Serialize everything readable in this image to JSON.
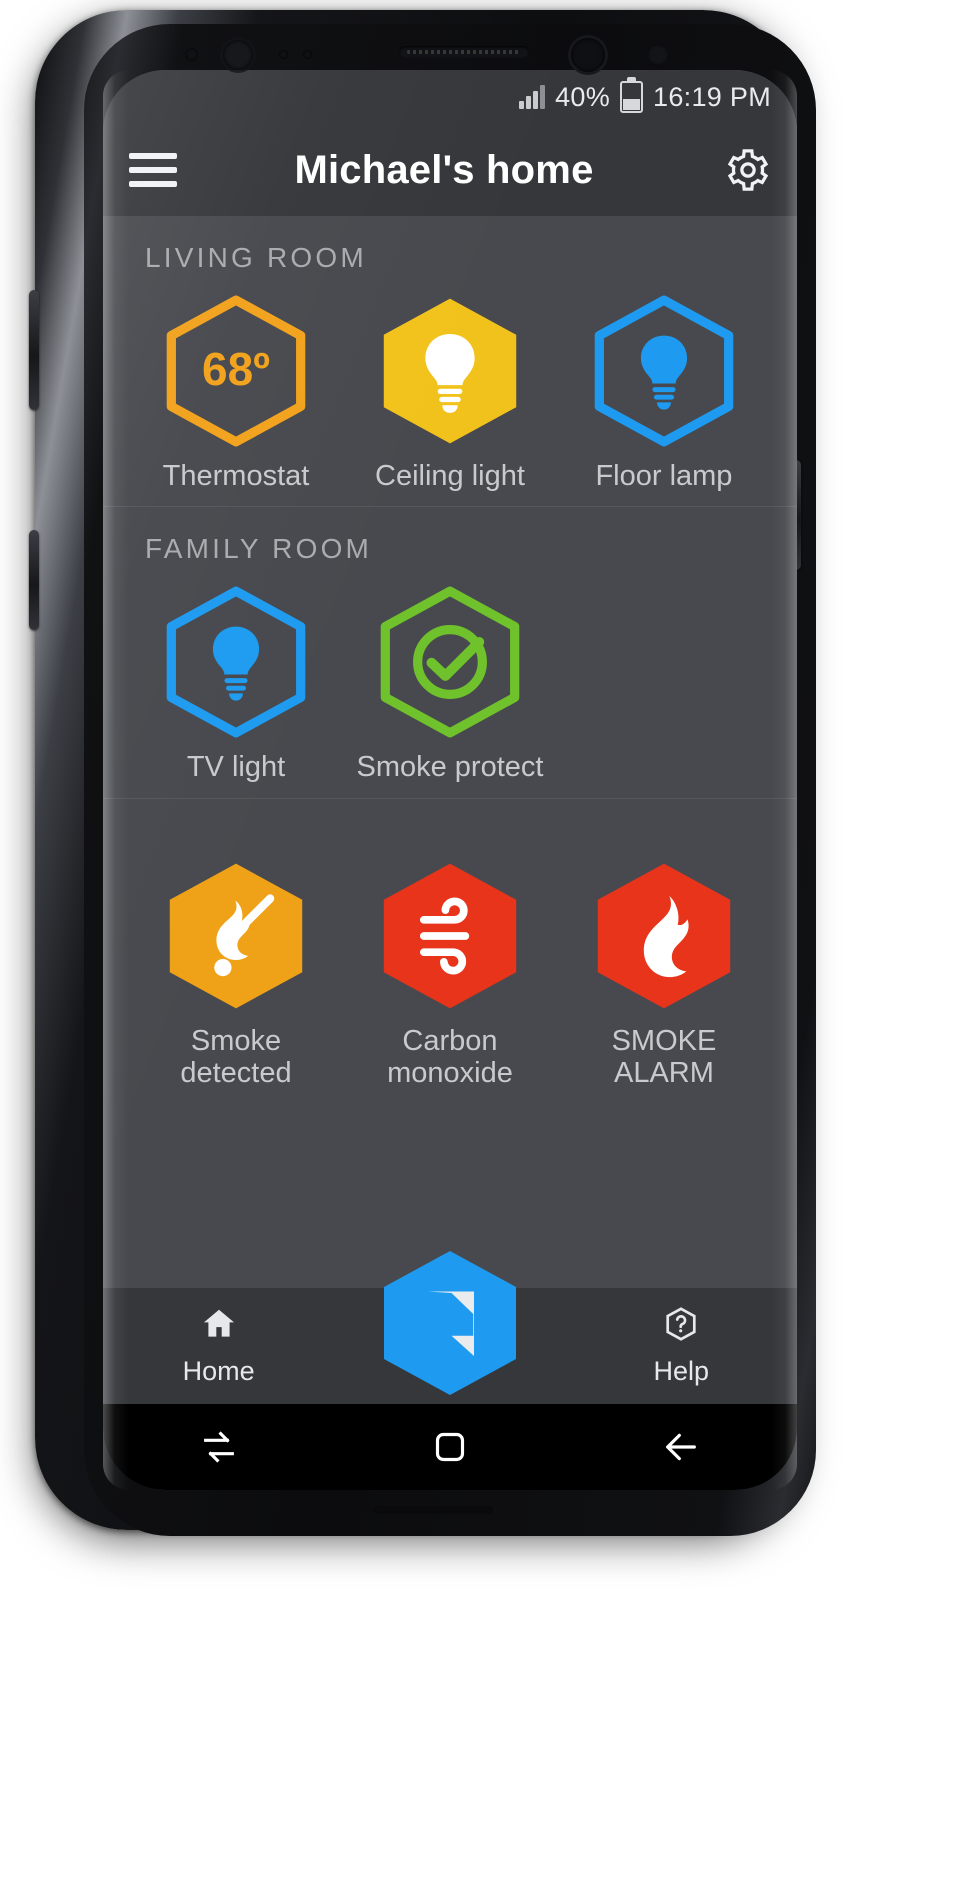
{
  "status_bar": {
    "battery_percent": "40%",
    "battery_level": 40,
    "time": "16:19 PM",
    "signal_icon": "signal-bars-icon",
    "battery_icon": "battery-icon"
  },
  "app_bar": {
    "menu_icon": "hamburger-menu-icon",
    "title": "Michael's home",
    "settings_icon": "gear-icon"
  },
  "colors": {
    "background": "#47494e",
    "bar": "#35373b",
    "orange": "#F2A21C",
    "yellow": "#F2C21C",
    "blue": "#1E9BF0",
    "green": "#6FC22B",
    "amber": "#EFA117",
    "red": "#E8341A",
    "label": "#c8cacd",
    "section_label": "#a9abaf"
  },
  "sections": [
    {
      "title": "LIVING ROOM",
      "devices": [
        {
          "label": "Thermostat",
          "icon": "thermostat-icon",
          "value": "68º",
          "style": "outline",
          "color": "#F2A21C"
        },
        {
          "label": "Ceiling light",
          "icon": "lightbulb-icon",
          "value": "",
          "style": "filled",
          "color": "#F2C21C"
        },
        {
          "label": "Floor lamp",
          "icon": "lightbulb-icon",
          "value": "",
          "style": "outline",
          "color": "#1E9BF0"
        }
      ]
    },
    {
      "title": "FAMILY ROOM",
      "devices": [
        {
          "label": "TV light",
          "icon": "lightbulb-icon",
          "value": "",
          "style": "outline",
          "color": "#1E9BF0"
        },
        {
          "label": "Smoke protect",
          "icon": "check-circle-icon",
          "value": "",
          "style": "outline",
          "color": "#6FC22B"
        }
      ]
    },
    {
      "title": "",
      "devices": [
        {
          "label": "Smoke\ndetected",
          "icon": "match-flame-icon",
          "value": "",
          "style": "filled",
          "color": "#EFA117"
        },
        {
          "label": "Carbon\nmonoxide",
          "icon": "wind-icon",
          "value": "",
          "style": "filled",
          "color": "#E8341A"
        },
        {
          "label": "SMOKE\nALARM",
          "icon": "fire-icon",
          "value": "",
          "style": "filled",
          "color": "#E8341A"
        }
      ]
    }
  ],
  "bottom_nav": {
    "home": {
      "label": "Home",
      "icon": "home-icon"
    },
    "logo": {
      "label": "",
      "icon": "app-logo-hexagon-icon",
      "color": "#1E9BF0"
    },
    "help": {
      "label": "Help",
      "icon": "question-circle-icon"
    }
  },
  "android_nav": {
    "recents_icon": "recents-icon",
    "home_icon": "home-square-icon",
    "back_icon": "back-arrow-icon"
  }
}
